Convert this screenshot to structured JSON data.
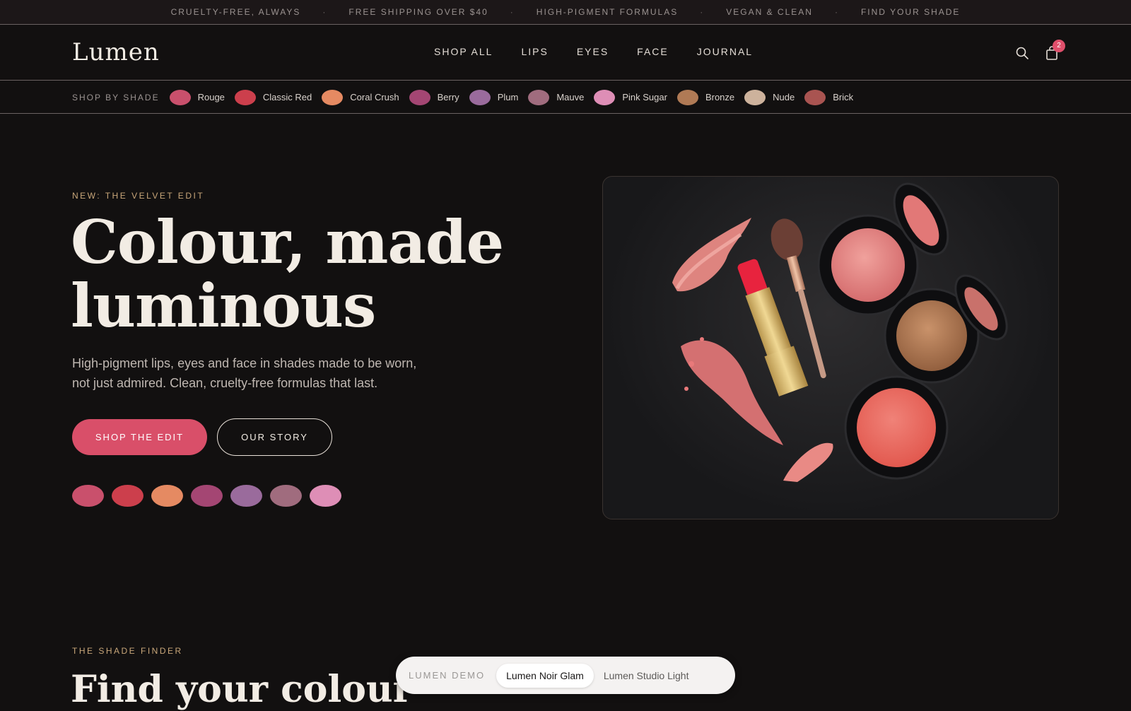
{
  "announcement": {
    "messages": [
      "CRUELTY-FREE, ALWAYS",
      "FREE SHIPPING OVER $40",
      "HIGH-PIGMENT FORMULAS",
      "VEGAN & CLEAN",
      "FIND YOUR SHADE"
    ],
    "separator": "·"
  },
  "header": {
    "logo": "Lumen",
    "nav": [
      "SHOP ALL",
      "LIPS",
      "EYES",
      "FACE",
      "JOURNAL"
    ],
    "cart_count": "2",
    "icons": [
      "search-icon",
      "bag-icon"
    ]
  },
  "shade_bar": {
    "label": "SHOP BY SHADE",
    "shades": [
      {
        "name": "Rouge",
        "color": "#c9506c"
      },
      {
        "name": "Classic Red",
        "color": "#cc3f4c"
      },
      {
        "name": "Coral Crush",
        "color": "#e58a62"
      },
      {
        "name": "Berry",
        "color": "#a44673"
      },
      {
        "name": "Plum",
        "color": "#9a6b9c"
      },
      {
        "name": "Mauve",
        "color": "#a06c7e"
      },
      {
        "name": "Pink Sugar",
        "color": "#de8eb6"
      },
      {
        "name": "Bronze",
        "color": "#b07a55"
      },
      {
        "name": "Nude",
        "color": "#cdb29c"
      },
      {
        "name": "Brick",
        "color": "#a95451"
      }
    ]
  },
  "hero": {
    "eyebrow": "NEW: THE VELVET EDIT",
    "headline": "Colour, made luminous",
    "subtext": "High-pigment lips, eyes and face in shades made to be worn, not just admired. Clean, cruelty-free formulas that last.",
    "primary_cta": "SHOP THE EDIT",
    "secondary_cta": "OUR STORY",
    "swatch_colors": [
      "#c9506c",
      "#cc3f4c",
      "#e58a62",
      "#a44673",
      "#9a6b9c",
      "#a06c7e",
      "#de8eb6"
    ]
  },
  "shade_finder": {
    "eyebrow": "THE SHADE FINDER",
    "headline": "Find your colour"
  },
  "demo_switcher": {
    "label": "LUMEN DEMO",
    "options": [
      "Lumen Noir Glam",
      "Lumen Studio Light"
    ],
    "active": "Lumen Noir Glam"
  },
  "colors": {
    "background": "#121010",
    "accent": "#d94f69",
    "gold": "#c9a77a"
  }
}
